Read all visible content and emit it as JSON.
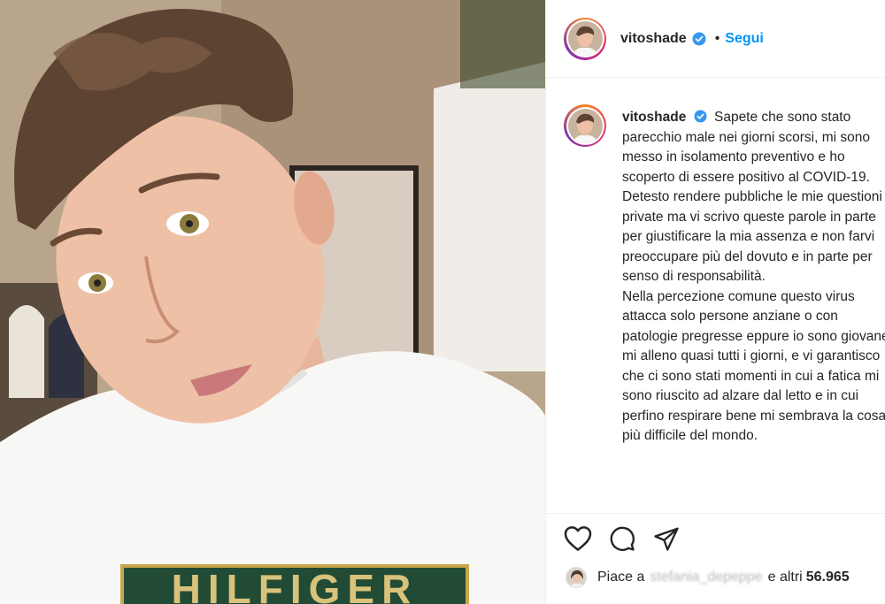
{
  "post": {
    "photo_description": "selfie",
    "shirt_text": "HILFIGER"
  },
  "header": {
    "username": "vitoshade",
    "dot": "•",
    "follow_label": "Segui"
  },
  "caption": {
    "username": "vitoshade",
    "paragraphs": [
      "Sapete che sono stato parecchio male nei giorni scorsi, mi sono messo in isolamento preventivo e ho scoperto di essere positivo al COVID-19.",
      "Detesto rendere pubbliche le mie questioni private ma vi scrivo queste parole in parte per giustificare la mia assenza e non farvi preoccupare più del dovuto e in parte per senso di responsabilità.",
      "Nella percezione comune questo virus attacca solo persone anziane o con patologie pregresse eppure io sono giovane, mi alleno quasi tutti i giorni, e vi garantisco che ci sono stati momenti in cui a fatica mi sono riuscito ad alzare dal letto e in cui perfino respirare bene mi sembrava la cosa più difficile del mondo."
    ]
  },
  "likes": {
    "prefix": "Piace a",
    "liker": "stefania_depeppe",
    "suffix": "e altri",
    "count": "56.965"
  },
  "colors": {
    "accent": "#0095f6",
    "verified": "#3897f0",
    "text": "#262626"
  }
}
